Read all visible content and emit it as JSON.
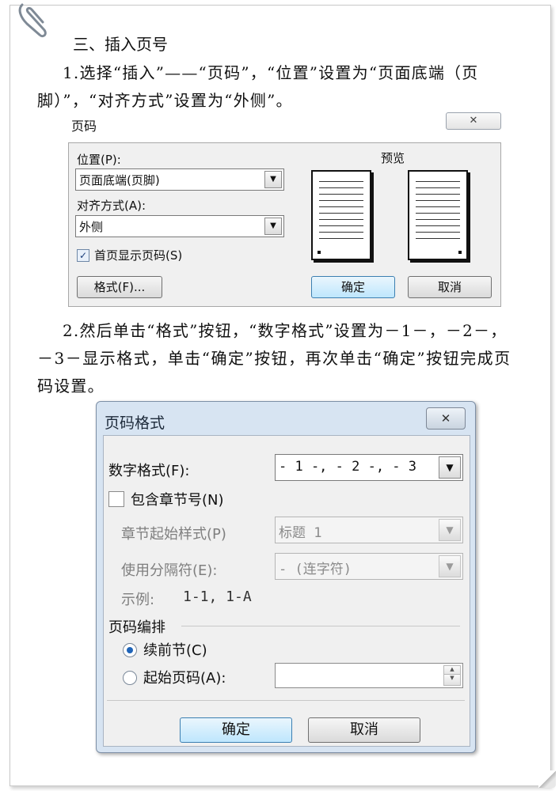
{
  "article": {
    "heading": "三、插入页号",
    "para1_line1": "1.选择“插入”——“页码”，“位置”设置为“页面底端（页",
    "para1_line2": "脚）”，“对齐方式”设置为“外侧”。",
    "para2_line1": "2.然后单击“格式”按钮，“数字格式”设置为－1－，－2－，",
    "para2_line2": "－3－显示格式，单击“确定”按钮，再次单击“确定”按钮完成页",
    "para2_line3": "码设置。"
  },
  "dialog_page_numbers": {
    "title": "页码",
    "close_glyph": "✕",
    "position_label": "位置(P):",
    "position_value": "页面底端(页脚)",
    "alignment_label": "对齐方式(A):",
    "alignment_value": "外侧",
    "show_first_page_label": "首页显示页码(S)",
    "show_first_page_checked": true,
    "preview_label": "预览",
    "format_button": "格式(F)...",
    "ok_button": "确定",
    "cancel_button": "取消"
  },
  "dialog_page_format": {
    "title": "页码格式",
    "close_glyph": "✕",
    "number_format_label": "数字格式(F):",
    "number_format_value": "- 1 -, - 2 -, - 3",
    "include_chapter_label": "包含章节号(N)",
    "include_chapter_checked": false,
    "chapter_style_label": "章节起始样式(P)",
    "chapter_style_value": "标题 1",
    "separator_label": "使用分隔符(E):",
    "separator_value": "-  (连字符)",
    "example_label": "示例:",
    "example_value": "1-1, 1-A",
    "numbering_group_label": "页码编排",
    "continue_label": "续前节(C)",
    "start_at_label": "起始页码(A):",
    "start_at_value": "",
    "ok_button": "确定",
    "cancel_button": "取消"
  }
}
